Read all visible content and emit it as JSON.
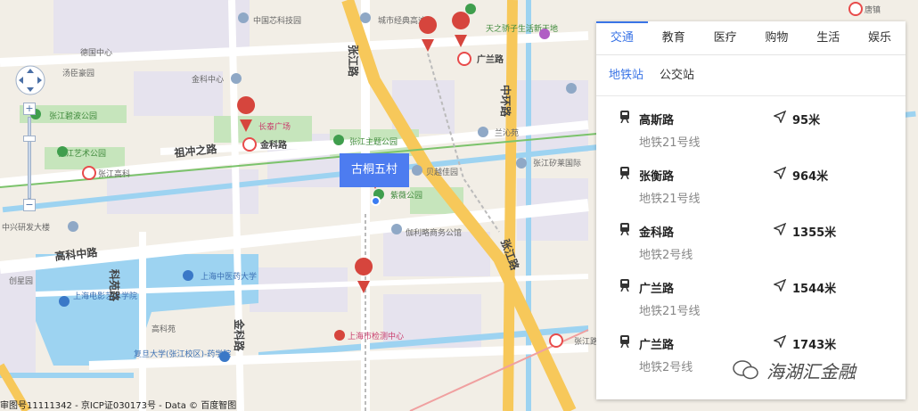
{
  "location": {
    "name": "古桐五村"
  },
  "map_labels": {
    "pois": [
      "中国芯科技园",
      "城市经典高迪",
      "天之骄子生活新天地",
      "德国中心",
      "汤臣豪园",
      "金科中心",
      "张江碧波公园",
      "长泰广场",
      "张江主题公园",
      "兰沁苑",
      "贝越佳园",
      "张江矽莱国际",
      "张江艺术公园",
      "张江高科",
      "紫薇公园",
      "中兴研发大楼",
      "伽利略商务公馆",
      "上海中医药大学",
      "创星园",
      "上海电影艺术学院",
      "高科苑",
      "上海市检测中心",
      "复旦大学(张江校区)-药学院",
      "张江路",
      "唐镇"
    ],
    "roads": [
      "张江路",
      "中环路",
      "广兰路",
      "祖冲之路",
      "金科路",
      "高科中路",
      "科苑路",
      "张江路",
      "金科路"
    ],
    "stations_on_map": [
      "广兰路",
      "金科路",
      "张江高科",
      "张江路"
    ]
  },
  "panel": {
    "tabs": [
      "交通",
      "教育",
      "医疗",
      "购物",
      "生活",
      "娱乐"
    ],
    "active_tab": "交通",
    "subtabs": [
      "地铁站",
      "公交站"
    ],
    "active_subtab": "地铁站",
    "stations": [
      {
        "name": "高斯路",
        "line": "地铁21号线",
        "distance": "95米"
      },
      {
        "name": "张衡路",
        "line": "地铁21号线",
        "distance": "964米"
      },
      {
        "name": "金科路",
        "line": "地铁2号线",
        "distance": "1355米"
      },
      {
        "name": "广兰路",
        "line": "地铁21号线",
        "distance": "1544米"
      },
      {
        "name": "广兰路",
        "line": "地铁2号线",
        "distance": "1743米"
      }
    ]
  },
  "zoom": {
    "plus": "+",
    "minus": "−"
  },
  "copyright": "审图号11111342 - 京ICP证030173号 - Data © 百度智图",
  "watermark": "海湖汇金融",
  "colors": {
    "accent": "#3a74e6",
    "marker": "#d6453d",
    "metro": "#e84b4b",
    "water": "#9dd3f1",
    "green": "#c6e5bc",
    "highway": "#f7c85a"
  }
}
